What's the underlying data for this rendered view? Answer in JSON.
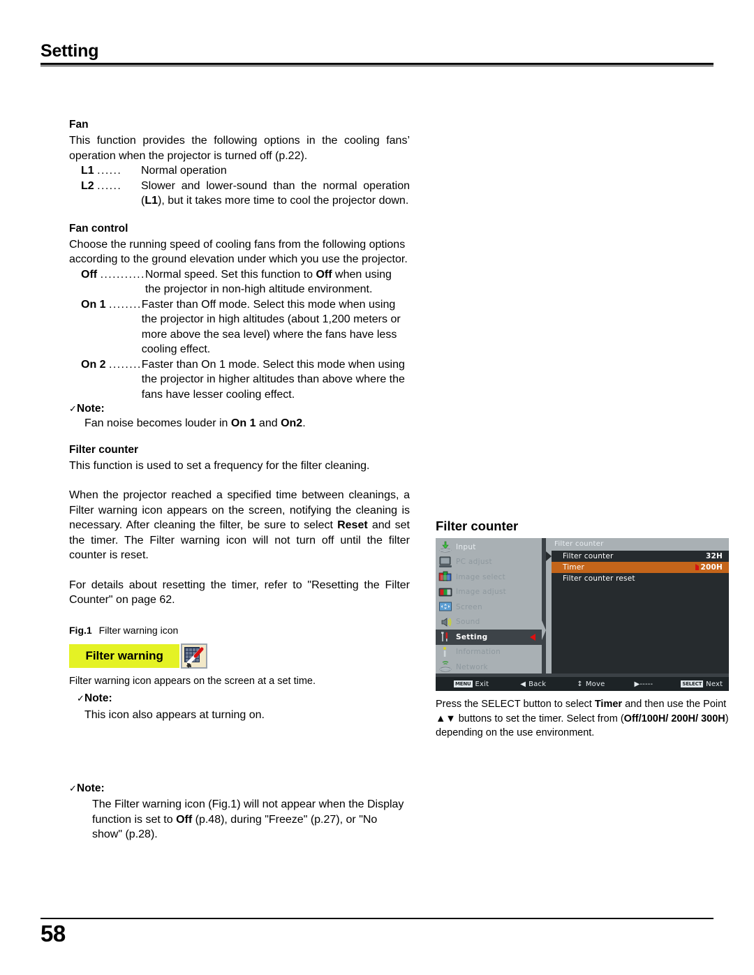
{
  "header": {
    "chapter": "Setting"
  },
  "footer": {
    "page_number": "58"
  },
  "fan": {
    "heading": "Fan",
    "intro": "This function provides the following options in the cooling fans’ operation when the projector is turned off (p.22).",
    "options": [
      {
        "term": "L1",
        "dots": "......",
        "desc": "Normal operation"
      },
      {
        "term": "L2",
        "dots": "......",
        "desc": "Slower and lower-sound than the normal operation (L1), but it takes more time to cool the projector down.",
        "desc_pre": "Slower and lower-sound than the normal operation (",
        "desc_bold": "L1",
        "desc_post": "), but it takes more time to cool the projector down."
      }
    ]
  },
  "fan_control": {
    "heading": "Fan control",
    "intro": "Choose the running speed of cooling fans from the following options according to the ground elevation under which you use the projector.",
    "options": [
      {
        "term": "Off",
        "dots": "...........",
        "desc_pre": "Normal speed. Set this function to ",
        "desc_bold": "Off",
        "desc_post": " when using the projector in non-high altitude environment."
      },
      {
        "term": "On 1",
        "dots": "........",
        "desc_pre": "Faster than Off mode. Select this mode when using the projector in high altitudes (about 1,200 meters or more above the sea level) where the fans have less cooling effect.",
        "desc_bold": "",
        "desc_post": ""
      },
      {
        "term": "On 2",
        "dots": "........",
        "desc_pre": "Faster than On 1 mode. Select this mode when using the projector in higher altitudes than above where the fans have lesser cooling effect.",
        "desc_bold": "",
        "desc_post": ""
      }
    ],
    "note": {
      "label": "Note:",
      "check": "✓",
      "text_pre": "Fan noise becomes louder in ",
      "text_bold1": "On 1",
      "text_mid": " and ",
      "text_bold2": "On2",
      "text_post": "."
    }
  },
  "filter_counter": {
    "heading": "Filter counter",
    "para1": "This function is used to set a frequency for the filter cleaning.",
    "para2_pre": "When the projector reached a specified time between cleanings, a Filter warning icon appears on the screen, notifying the cleaning is necessary. After cleaning the filter, be sure to select ",
    "para2_bold": "Reset",
    "para2_post": " and set the timer. The Filter warning icon will not turn off until the filter counter is reset.",
    "para3": "For details about resetting the timer, refer to \"Resetting the Filter Counter\" on page 62."
  },
  "figure": {
    "label": "Fig.1",
    "caption": "Filter warning icon",
    "banner_text": "Filter warning",
    "banner_color": "#e4f225",
    "icon_name": "filter-brush-icon",
    "below_text": "Filter warning icon appears on the screen at a set time."
  },
  "note_icon": {
    "check": "✓",
    "label": "Note:",
    "text": "This icon also appears at turning on."
  },
  "note_display": {
    "check": "✓",
    "label": "Note:",
    "text_pre": "The Filter warning icon (Fig.1) will not appear when the Display function is set to ",
    "text_bold": "Off",
    "text_post": " (p.48),  during \"Freeze\" (p.27), or \"No show\" (p.28)."
  },
  "osd": {
    "title": "Filter counter",
    "accent_orange": "#c4651a",
    "accent_red": "#d41212",
    "sidebar_bg": "#a9b0b4",
    "panel_bg": "#262b2e",
    "sidebar": [
      {
        "label": "Input",
        "icon": "input-icon",
        "state": "normal"
      },
      {
        "label": "PC adjust",
        "icon": "monitor-icon",
        "state": "dim"
      },
      {
        "label": "Image select",
        "icon": "image-select-icon",
        "state": "dim"
      },
      {
        "label": "Image adjust",
        "icon": "image-adjust-icon",
        "state": "dim"
      },
      {
        "label": "Screen",
        "icon": "screen-icon",
        "state": "dim"
      },
      {
        "label": "Sound",
        "icon": "speaker-icon",
        "state": "dim"
      },
      {
        "label": "Setting",
        "icon": "wrench-icon",
        "state": "active"
      },
      {
        "label": "Information",
        "icon": "info-icon",
        "state": "dim"
      },
      {
        "label": "Network",
        "icon": "network-icon",
        "state": "dim"
      }
    ],
    "panel_title": "Filter counter",
    "rows": [
      {
        "label": "Filter counter",
        "value": "32H",
        "selected": false
      },
      {
        "label": "Timer",
        "value": "200H",
        "selected": true
      },
      {
        "label": "Filter counter reset",
        "value": "",
        "selected": false
      }
    ],
    "bottom_bar": [
      {
        "key": "MENU",
        "glyph": "",
        "label": "Exit"
      },
      {
        "key": "",
        "glyph": "◀",
        "label": "Back"
      },
      {
        "key": "",
        "glyph": "↕",
        "label": "Move"
      },
      {
        "key": "",
        "glyph": "▶-----",
        "label": ""
      },
      {
        "key": "SELECT",
        "glyph": "",
        "label": "Next"
      }
    ],
    "caption_pre": "Press the SELECT button to select  ",
    "caption_bold1": "Timer",
    "caption_mid": " and then use the Point ▲▼ buttons to set the timer. Select from (",
    "caption_bold2": "Off/100H/ 200H/ 300H",
    "caption_post": ") depending on the use environment."
  }
}
